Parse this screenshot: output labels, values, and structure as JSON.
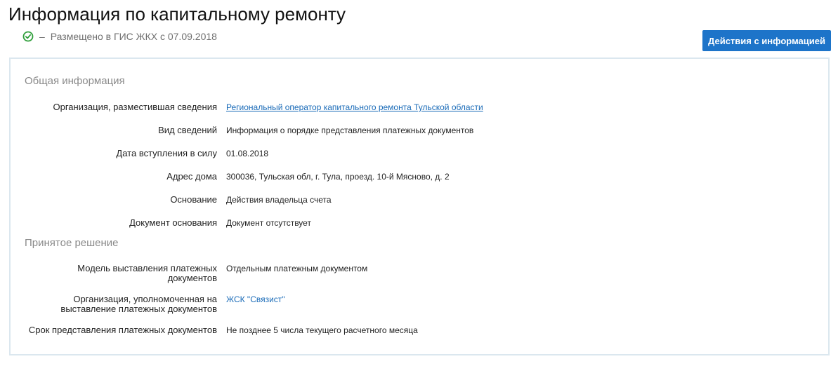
{
  "page": {
    "title": "Информация по капитальному ремонту",
    "status_dash": "–",
    "status_text": "Размещено в ГИС ЖКХ с 07.09.2018",
    "status_icon": "check-circle-icon",
    "status_color": "#2e9e3a"
  },
  "actions": {
    "button_label": "Действия с информацией",
    "button_color": "#1d74c9"
  },
  "general": {
    "section_title": "Общая информация",
    "rows": [
      {
        "label": "Организация, разместившая сведения",
        "value": "Региональный оператор капитального ремонта Тульской области"
      },
      {
        "label": "Вид сведений",
        "value": "Информация о порядке представления платежных документов"
      },
      {
        "label": "Дата вступления в силу",
        "value": "01.08.2018"
      },
      {
        "label": "Адрес дома",
        "value": "300036, Тульская обл, г. Тула, проезд. 10-й Мясново, д. 2"
      },
      {
        "label": "Основание",
        "value": "Действия владельца счета"
      },
      {
        "label": "Документ основания",
        "value": "Документ отсутствует"
      }
    ]
  },
  "decision": {
    "section_title": "Принятое решение",
    "rows": [
      {
        "label_line1": "Модель выставления платежных",
        "label_line2": "документов",
        "value": "Отдельным платежным документом"
      },
      {
        "label_line1": "Организация, уполномоченная на",
        "label_line2": "выставление платежных документов",
        "value": "ЖСК \"Связист\""
      },
      {
        "label": "Срок представления платежных документов",
        "value": "Не позднее 5 числа текущего расчетного месяца"
      }
    ]
  },
  "link_color": "#1a6bb8"
}
